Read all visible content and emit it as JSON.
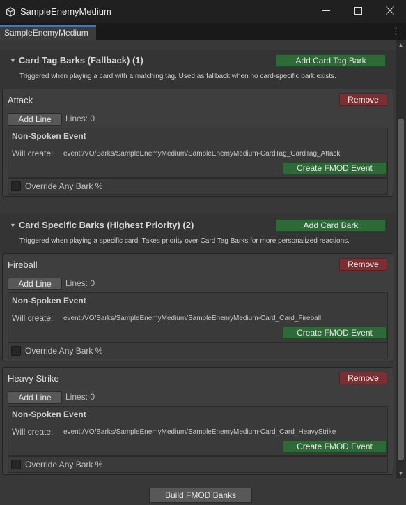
{
  "window": {
    "title": "SampleEnemyMedium",
    "minimize_icon": "minimize-icon",
    "maximize_icon": "maximize-icon",
    "close_icon": "close-icon"
  },
  "tab": {
    "label": "SampleEnemyMedium",
    "menu_icon": "kebab-menu-icon"
  },
  "card_tag_section": {
    "title": "Card Tag Barks (Fallback) (1)",
    "description": "Triggered when playing a card with a matching tag. Used as fallback when no card-specific bark exists.",
    "add_button": "Add Card Tag Bark",
    "items": [
      {
        "name": "Attack",
        "remove": "Remove",
        "add_line": "Add Line",
        "lines": "Lines: 0",
        "event_title": "Non-Spoken Event",
        "will_create_label": "Will create:",
        "event_path": "event:/VO/Barks/SampleEnemyMedium/SampleEnemyMedium-CardTag_CardTag_Attack",
        "create_button": "Create FMOD Event",
        "override_label": "Override Any Bark %",
        "override_checked": false
      }
    ]
  },
  "card_specific_section": {
    "title": "Card Specific Barks (Highest Priority) (2)",
    "description": "Triggered when playing a specific card. Takes priority over Card Tag Barks for more personalized reactions.",
    "add_button": "Add Card Bark",
    "items": [
      {
        "name": "Fireball",
        "remove": "Remove",
        "add_line": "Add Line",
        "lines": "Lines: 0",
        "event_title": "Non-Spoken Event",
        "will_create_label": "Will create:",
        "event_path": "event:/VO/Barks/SampleEnemyMedium/SampleEnemyMedium-Card_Card_Fireball",
        "create_button": "Create FMOD Event",
        "override_label": "Override Any Bark %",
        "override_checked": false
      },
      {
        "name": "Heavy Strike",
        "remove": "Remove",
        "add_line": "Add Line",
        "lines": "Lines: 0",
        "event_title": "Non-Spoken Event",
        "will_create_label": "Will create:",
        "event_path": "event:/VO/Barks/SampleEnemyMedium/SampleEnemyMedium-Card_Card_HeavyStrike",
        "create_button": "Create FMOD Event",
        "override_label": "Override Any Bark %",
        "override_checked": false
      }
    ]
  },
  "footer": {
    "build_button": "Build FMOD Banks"
  },
  "colors": {
    "accent": "#3a79bb",
    "green_button": "#2d6a37",
    "red_button": "#7a2f33",
    "background": "#383838"
  }
}
